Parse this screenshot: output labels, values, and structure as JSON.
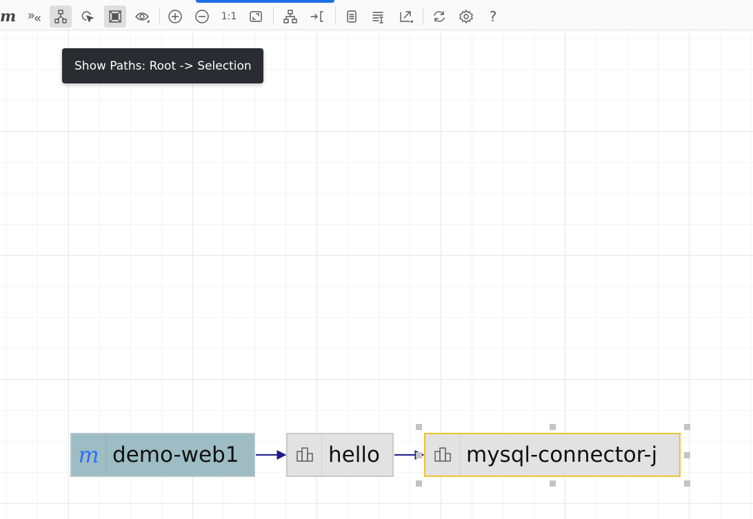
{
  "toolbar": {
    "logo": "m",
    "buttons": [
      {
        "name": "collapse-expand",
        "icon": "double-chevron-icon"
      },
      {
        "name": "show-paths",
        "icon": "tree-paths-icon",
        "active": true
      },
      {
        "name": "select",
        "icon": "cursor-select-icon"
      },
      {
        "name": "fit-selection",
        "icon": "frame-icon",
        "active": true
      },
      {
        "name": "visibility",
        "icon": "eye-icon"
      },
      {
        "name": "zoom-in",
        "icon": "zoom-in-icon"
      },
      {
        "name": "zoom-out",
        "icon": "zoom-out-icon"
      },
      {
        "name": "actual-size",
        "label": "1:1"
      },
      {
        "name": "fit-window",
        "icon": "fit-window-icon"
      },
      {
        "name": "layout",
        "icon": "hierarchy-icon"
      },
      {
        "name": "goto",
        "icon": "goto-bracket-icon"
      },
      {
        "name": "copy",
        "icon": "document-icon"
      },
      {
        "name": "search-text",
        "icon": "text-search-icon"
      },
      {
        "name": "export",
        "icon": "export-icon"
      },
      {
        "name": "refresh",
        "icon": "refresh-icon"
      },
      {
        "name": "settings",
        "icon": "gear-icon"
      },
      {
        "name": "help",
        "label": "?"
      }
    ]
  },
  "tooltip": {
    "text": "Show Paths: Root -> Selection"
  },
  "graph": {
    "nodes": [
      {
        "id": "root",
        "label": "demo-web1",
        "icon": "m"
      },
      {
        "id": "hello",
        "label": "hello",
        "icon": "module-icon"
      },
      {
        "id": "mysql",
        "label": "mysql-connector-j",
        "icon": "module-icon",
        "selected": true
      }
    ],
    "edges": [
      {
        "from": "root",
        "to": "hello"
      },
      {
        "from": "hello",
        "to": "mysql"
      }
    ]
  },
  "colors": {
    "root_node": "#9dbcc3",
    "dependency_node": "#e2e2e2",
    "selected_border": "#f2c32b",
    "edge": "#1a1a8c",
    "tooltip_bg": "#2b2c31",
    "progress": "#1e6fe6",
    "logo_m_root": "#2f6ef0"
  }
}
